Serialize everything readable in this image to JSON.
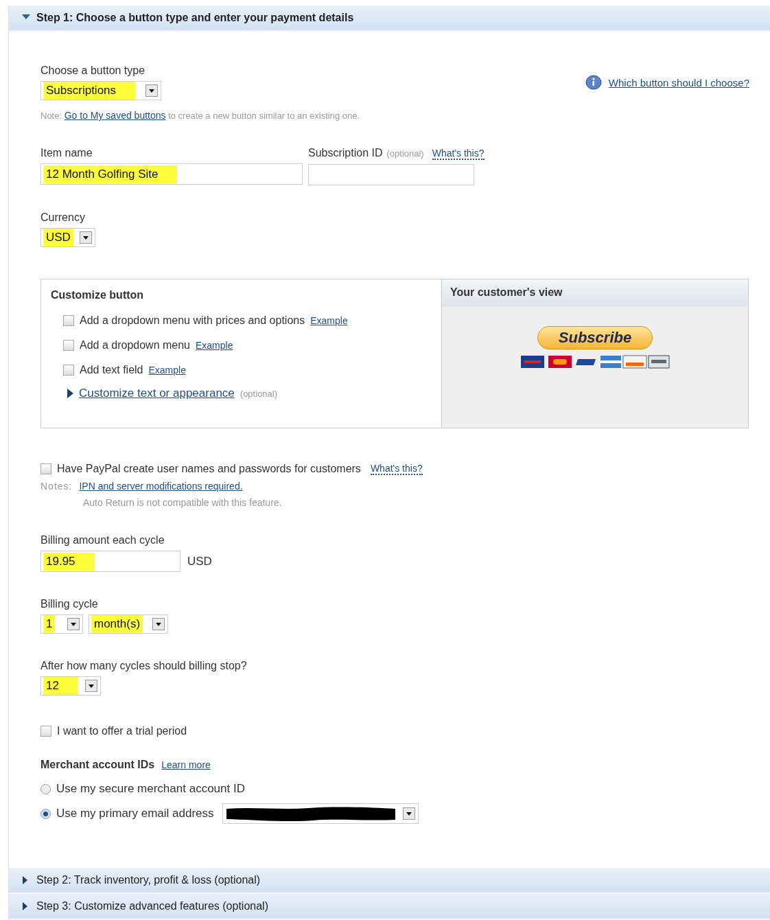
{
  "steps": [
    {
      "title": "Step 1: Choose a button type and enter your payment details",
      "expanded": true
    },
    {
      "title": "Step 2: Track inventory, profit & loss (optional)",
      "expanded": false
    },
    {
      "title": "Step 3: Customize advanced features (optional)",
      "expanded": false
    }
  ],
  "help_link": "Which button should I choose?",
  "button_type": {
    "label": "Choose a button type",
    "value": "Subscriptions",
    "highlighted": true
  },
  "note": {
    "prefix": "Note:",
    "link": "Go to My saved buttons",
    "text": "to create a new button similar to an existing one."
  },
  "item_name": {
    "label": "Item name",
    "value": "12 Month Golfing Site",
    "highlighted": true
  },
  "subscription_id": {
    "label": "Subscription ID",
    "hint": "(optional)",
    "link": "What's this?"
  },
  "currency": {
    "label": "Currency",
    "value": "USD",
    "highlighted": true
  },
  "customize": {
    "title": "Customize button",
    "options": [
      {
        "label": "Add a dropdown menu with prices and options",
        "link": "Example",
        "checked": false
      },
      {
        "label": "Add a dropdown menu",
        "link": "Example",
        "checked": false
      },
      {
        "label": "Add text field",
        "link": "Example",
        "checked": false
      }
    ],
    "more_link": "Customize text or appearance",
    "more_hint": "(optional)",
    "preview_title": "Your customer's view",
    "preview_button": "Subscribe"
  },
  "create_accounts": {
    "label": "Have PayPal create user names and passwords for customers",
    "link": "What's this?",
    "checked": false,
    "notes_label": "Notes:",
    "notes_link": "IPN and server modifications required.",
    "notes_text": "Auto Return is not compatible with this feature."
  },
  "billing_amount": {
    "label": "Billing amount each cycle",
    "value": "19.95",
    "unit": "USD",
    "highlighted": true
  },
  "billing_cycle": {
    "label": "Billing cycle",
    "fields": [
      {
        "value": "1",
        "highlighted": true
      },
      {
        "value": "month(s)",
        "highlighted": true
      }
    ]
  },
  "billing_stop": {
    "label": "After how many cycles should billing stop?",
    "value": "12",
    "highlighted": true
  },
  "trial": {
    "label": "I want to offer a trial period",
    "checked": false
  },
  "merchant": {
    "title": "Merchant account IDs",
    "link": "Learn more",
    "options": [
      {
        "label": "Use my secure merchant account ID",
        "selected": false
      },
      {
        "label": "Use my primary email address",
        "selected": true
      }
    ]
  }
}
